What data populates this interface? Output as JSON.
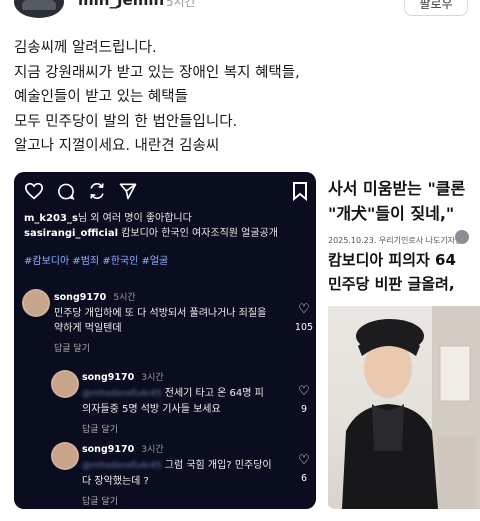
{
  "header": {
    "username": "min_Jemin",
    "time": "5시간",
    "follow_label": "팔로우"
  },
  "post": {
    "lines": [
      "김송씨께 알려드립니다.",
      "지금 강원래씨가 받고 있는 장애인 복지 혜택들,",
      "예술인들이 받고 있는 혜택들",
      "모두 민주당이 발의 한 법안들입니다.",
      "알고나 지껄이세요. 내란견 김송씨"
    ]
  },
  "instagram": {
    "likes_line_user": "m_k203_s",
    "likes_line_rest": "님 외 여러 명이 좋아합니다",
    "caption_user": "sasirangi_official",
    "caption_text": "캄보디아 한국인 여자조직원 얼굴공개",
    "hashtags": "#캄보디아 #범죄 #한국인 #얼굴",
    "comments": [
      {
        "user": "song9170",
        "time": "5시간",
        "lines": [
          "민주당 개입하에 또 다 석방되서 풀려나거나 죄질을",
          "약하게 먹일텐데"
        ],
        "reply": "답글 달기",
        "likes": "105"
      },
      {
        "user": "song9170",
        "time": "3시간",
        "mention": "@mhsdsnefu4r45",
        "lines": [
          "전세기 타고 온 64명 피",
          "의자들중 5명 석방 기사들 보세요"
        ],
        "reply": "답글 달기",
        "likes": "9"
      },
      {
        "user": "song9170",
        "time": "3시간",
        "mention": "@mhsdsnefu4r45",
        "lines": [
          "그럼 국힘 개입? 민주당이",
          "다 장악했는데 ?"
        ],
        "reply": "답글 달기",
        "likes": "6"
      }
    ]
  },
  "article": {
    "headline_1": "사서 미움받는 \"클론",
    "headline_2": "\"개犬\"들이 짖네,\"",
    "meta": "2025.10.23. 우리기인로사 나도기자단",
    "subhead_1": "캄보디아 피의자 64",
    "subhead_2": "민주당 비판 글올려,"
  }
}
